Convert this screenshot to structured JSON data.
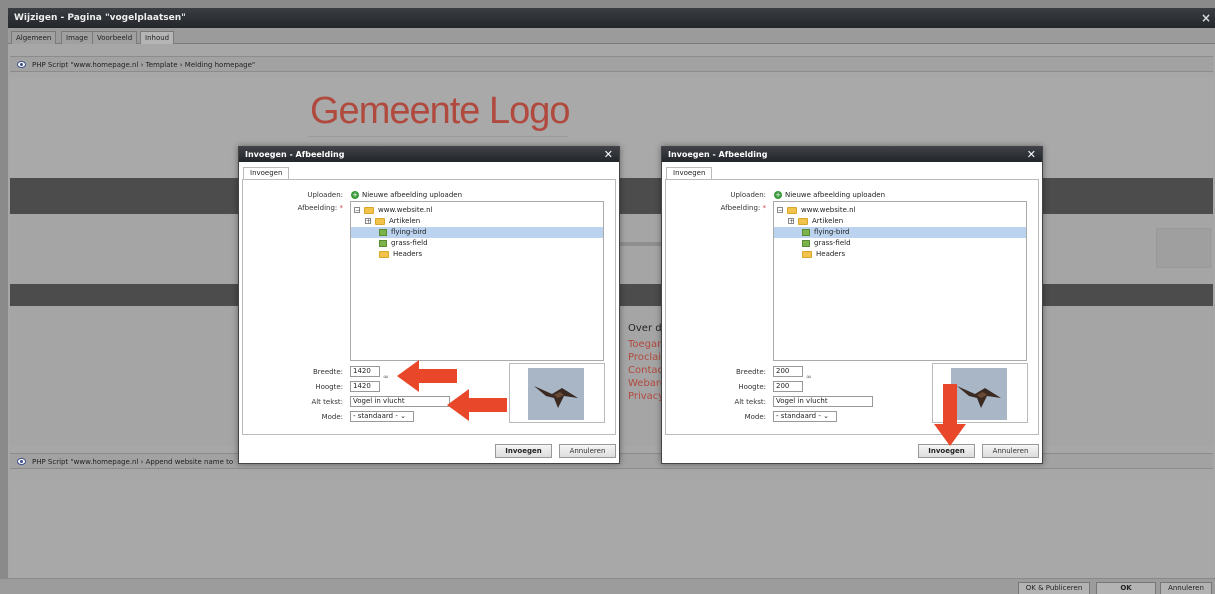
{
  "window": {
    "title": "Wijzigen - Pagina \"vogelplaatsen\"",
    "close": "×"
  },
  "tabs": [
    "Algemeen",
    "Image",
    "Voorbeeld",
    "Inhoud"
  ],
  "script_top": "PHP Script \"www.homepage.nl › Template › Melding homepage\"",
  "script_bottom": "PHP Script \"www.homepage.nl › Append website name to",
  "logo_text": "Gemeente Logo",
  "content_partial": {
    "heading": "Over de",
    "links": [
      "Toegank",
      "Proclaim",
      "Contact",
      "Webarch",
      "Privacy v"
    ]
  },
  "footer": {
    "publish": "OK & Publiceren",
    "ok": "OK",
    "cancel": "Annuleren"
  },
  "dialog_left": {
    "title": "Invoegen - Afbeelding",
    "tab": "Invoegen",
    "upload_label": "Uploaden:",
    "upload_link": "Nieuwe afbeelding uploaden",
    "image_label": "Afbeelding:",
    "required": "*",
    "tree": [
      "www.website.nl",
      "Artikelen",
      "flying-bird",
      "grass-field",
      "Headers"
    ],
    "width_label": "Breedte:",
    "width_value": "1420",
    "height_label": "Hoogte:",
    "height_value": "1420",
    "alt_label": "Alt tekst:",
    "alt_value": "Vogel in vlucht",
    "mode_label": "Mode:",
    "mode_value": "- standaard -",
    "insert": "Invoegen",
    "cancel": "Annuleren"
  },
  "dialog_right": {
    "title": "Invoegen - Afbeelding",
    "tab": "Invoegen",
    "upload_label": "Uploaden:",
    "upload_link": "Nieuwe afbeelding uploaden",
    "image_label": "Afbeelding:",
    "required": "*",
    "tree": [
      "www.website.nl",
      "Artikelen",
      "flying-bird",
      "grass-field",
      "Headers"
    ],
    "width_label": "Breedte:",
    "width_value": "200",
    "height_label": "Hoogte:",
    "height_value": "200",
    "alt_label": "Alt tekst:",
    "alt_value": "Vogel in vlucht",
    "mode_label": "Mode:",
    "mode_value": "- standaard -",
    "insert": "Invoegen",
    "cancel": "Annuleren"
  },
  "colors": {
    "accent_red": "#e8472a",
    "logo_red": "#b14a3e",
    "selection": "#bcd3ef"
  },
  "icons": [
    "close-icon",
    "eye-icon",
    "upload-plus-icon",
    "folder-icon",
    "image-file-icon",
    "chain-link-icon",
    "dropdown-chevron-icon",
    "arrow-icon"
  ]
}
